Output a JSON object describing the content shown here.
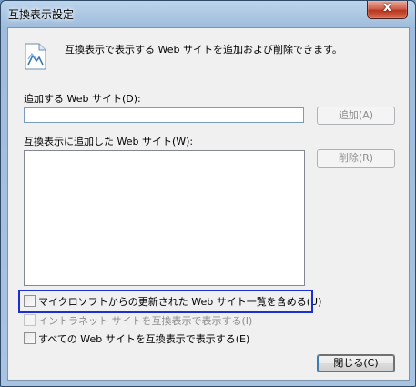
{
  "window": {
    "title": "互換表示設定",
    "close_glyph": "x",
    "close_icon": "close-icon"
  },
  "description": "互換表示で表示する Web サイトを追加および削除できます。",
  "add_site": {
    "label": "追加する Web サイト(D):",
    "value": "",
    "add_button": "追加(A)"
  },
  "site_list": {
    "label": "互換表示に追加した Web サイト(W):",
    "items": [],
    "remove_button": "削除(R)"
  },
  "options": [
    {
      "label": "マイクロソフトからの更新された Web サイト一覧を含める(U)",
      "checked": false,
      "enabled": true
    },
    {
      "label": "イントラネット サイトを互換表示で表示する(I)",
      "checked": false,
      "enabled": false
    },
    {
      "label": "すべての Web サイトを互換表示で表示する(E)",
      "checked": false,
      "enabled": true
    }
  ],
  "close_button": "閉じる(C)",
  "colors": {
    "highlight_border": "#1c2fd4",
    "title_bar": "#bcd4ec",
    "client_bg": "#f0f0f0"
  }
}
